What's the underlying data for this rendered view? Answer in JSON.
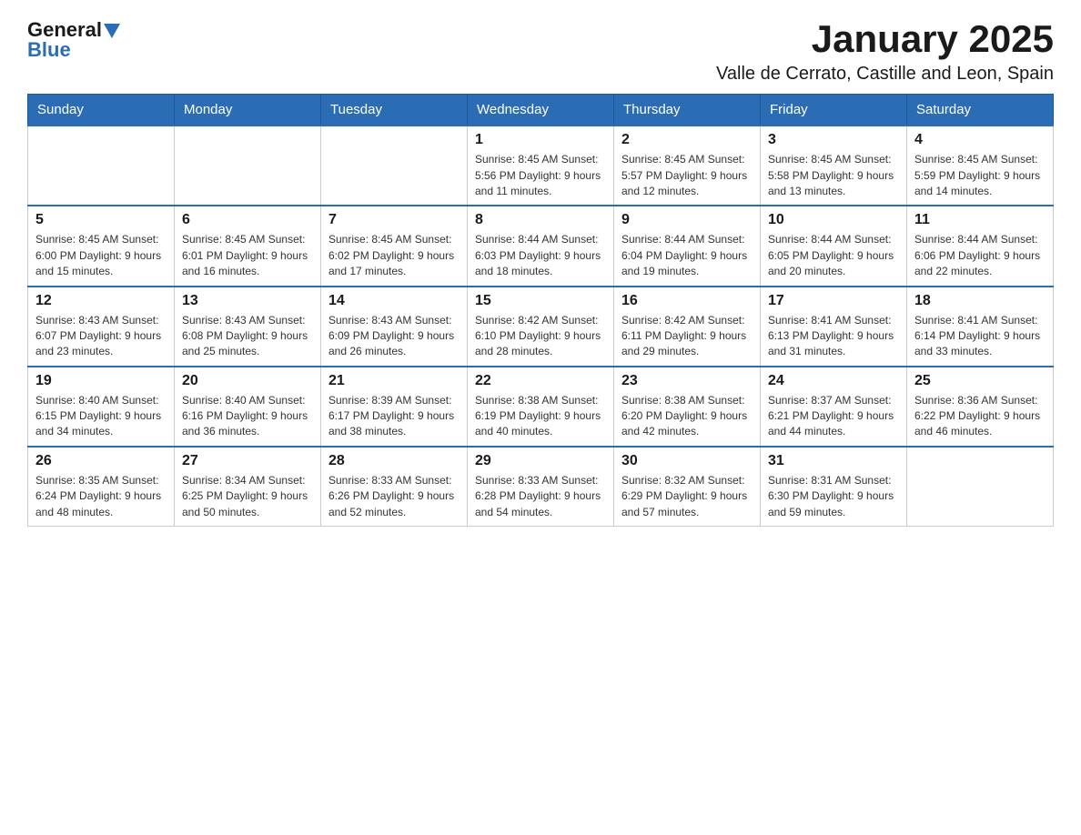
{
  "header": {
    "logo": {
      "general": "General",
      "blue": "Blue"
    },
    "month": "January 2025",
    "location": "Valle de Cerrato, Castille and Leon, Spain"
  },
  "weekdays": [
    "Sunday",
    "Monday",
    "Tuesday",
    "Wednesday",
    "Thursday",
    "Friday",
    "Saturday"
  ],
  "weeks": [
    [
      {
        "day": "",
        "info": ""
      },
      {
        "day": "",
        "info": ""
      },
      {
        "day": "",
        "info": ""
      },
      {
        "day": "1",
        "info": "Sunrise: 8:45 AM\nSunset: 5:56 PM\nDaylight: 9 hours\nand 11 minutes."
      },
      {
        "day": "2",
        "info": "Sunrise: 8:45 AM\nSunset: 5:57 PM\nDaylight: 9 hours\nand 12 minutes."
      },
      {
        "day": "3",
        "info": "Sunrise: 8:45 AM\nSunset: 5:58 PM\nDaylight: 9 hours\nand 13 minutes."
      },
      {
        "day": "4",
        "info": "Sunrise: 8:45 AM\nSunset: 5:59 PM\nDaylight: 9 hours\nand 14 minutes."
      }
    ],
    [
      {
        "day": "5",
        "info": "Sunrise: 8:45 AM\nSunset: 6:00 PM\nDaylight: 9 hours\nand 15 minutes."
      },
      {
        "day": "6",
        "info": "Sunrise: 8:45 AM\nSunset: 6:01 PM\nDaylight: 9 hours\nand 16 minutes."
      },
      {
        "day": "7",
        "info": "Sunrise: 8:45 AM\nSunset: 6:02 PM\nDaylight: 9 hours\nand 17 minutes."
      },
      {
        "day": "8",
        "info": "Sunrise: 8:44 AM\nSunset: 6:03 PM\nDaylight: 9 hours\nand 18 minutes."
      },
      {
        "day": "9",
        "info": "Sunrise: 8:44 AM\nSunset: 6:04 PM\nDaylight: 9 hours\nand 19 minutes."
      },
      {
        "day": "10",
        "info": "Sunrise: 8:44 AM\nSunset: 6:05 PM\nDaylight: 9 hours\nand 20 minutes."
      },
      {
        "day": "11",
        "info": "Sunrise: 8:44 AM\nSunset: 6:06 PM\nDaylight: 9 hours\nand 22 minutes."
      }
    ],
    [
      {
        "day": "12",
        "info": "Sunrise: 8:43 AM\nSunset: 6:07 PM\nDaylight: 9 hours\nand 23 minutes."
      },
      {
        "day": "13",
        "info": "Sunrise: 8:43 AM\nSunset: 6:08 PM\nDaylight: 9 hours\nand 25 minutes."
      },
      {
        "day": "14",
        "info": "Sunrise: 8:43 AM\nSunset: 6:09 PM\nDaylight: 9 hours\nand 26 minutes."
      },
      {
        "day": "15",
        "info": "Sunrise: 8:42 AM\nSunset: 6:10 PM\nDaylight: 9 hours\nand 28 minutes."
      },
      {
        "day": "16",
        "info": "Sunrise: 8:42 AM\nSunset: 6:11 PM\nDaylight: 9 hours\nand 29 minutes."
      },
      {
        "day": "17",
        "info": "Sunrise: 8:41 AM\nSunset: 6:13 PM\nDaylight: 9 hours\nand 31 minutes."
      },
      {
        "day": "18",
        "info": "Sunrise: 8:41 AM\nSunset: 6:14 PM\nDaylight: 9 hours\nand 33 minutes."
      }
    ],
    [
      {
        "day": "19",
        "info": "Sunrise: 8:40 AM\nSunset: 6:15 PM\nDaylight: 9 hours\nand 34 minutes."
      },
      {
        "day": "20",
        "info": "Sunrise: 8:40 AM\nSunset: 6:16 PM\nDaylight: 9 hours\nand 36 minutes."
      },
      {
        "day": "21",
        "info": "Sunrise: 8:39 AM\nSunset: 6:17 PM\nDaylight: 9 hours\nand 38 minutes."
      },
      {
        "day": "22",
        "info": "Sunrise: 8:38 AM\nSunset: 6:19 PM\nDaylight: 9 hours\nand 40 minutes."
      },
      {
        "day": "23",
        "info": "Sunrise: 8:38 AM\nSunset: 6:20 PM\nDaylight: 9 hours\nand 42 minutes."
      },
      {
        "day": "24",
        "info": "Sunrise: 8:37 AM\nSunset: 6:21 PM\nDaylight: 9 hours\nand 44 minutes."
      },
      {
        "day": "25",
        "info": "Sunrise: 8:36 AM\nSunset: 6:22 PM\nDaylight: 9 hours\nand 46 minutes."
      }
    ],
    [
      {
        "day": "26",
        "info": "Sunrise: 8:35 AM\nSunset: 6:24 PM\nDaylight: 9 hours\nand 48 minutes."
      },
      {
        "day": "27",
        "info": "Sunrise: 8:34 AM\nSunset: 6:25 PM\nDaylight: 9 hours\nand 50 minutes."
      },
      {
        "day": "28",
        "info": "Sunrise: 8:33 AM\nSunset: 6:26 PM\nDaylight: 9 hours\nand 52 minutes."
      },
      {
        "day": "29",
        "info": "Sunrise: 8:33 AM\nSunset: 6:28 PM\nDaylight: 9 hours\nand 54 minutes."
      },
      {
        "day": "30",
        "info": "Sunrise: 8:32 AM\nSunset: 6:29 PM\nDaylight: 9 hours\nand 57 minutes."
      },
      {
        "day": "31",
        "info": "Sunrise: 8:31 AM\nSunset: 6:30 PM\nDaylight: 9 hours\nand 59 minutes."
      },
      {
        "day": "",
        "info": ""
      }
    ]
  ]
}
